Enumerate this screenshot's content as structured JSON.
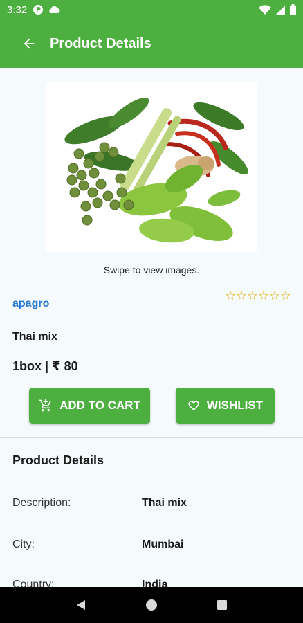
{
  "status_bar": {
    "time": "3:32"
  },
  "header": {
    "title": "Product Details"
  },
  "product": {
    "swipe_hint": "Swipe to view images.",
    "vendor": "apagro",
    "rating_stars_filled": 0,
    "rating_stars_total": 6,
    "name": "Thai mix",
    "price": "1box | ₹ 80"
  },
  "actions": {
    "add_to_cart": "ADD TO CART",
    "wishlist": "WISHLIST"
  },
  "details": {
    "title": "Product Details",
    "rows": [
      {
        "label": "Description:",
        "value": "Thai mix"
      },
      {
        "label": "City:",
        "value": "Mumbai"
      },
      {
        "label": "Country:",
        "value": "India"
      }
    ]
  },
  "colors": {
    "accent": "#4caf3f",
    "vendor_link": "#2a7ad8",
    "star_outline": "#e8c24a"
  }
}
